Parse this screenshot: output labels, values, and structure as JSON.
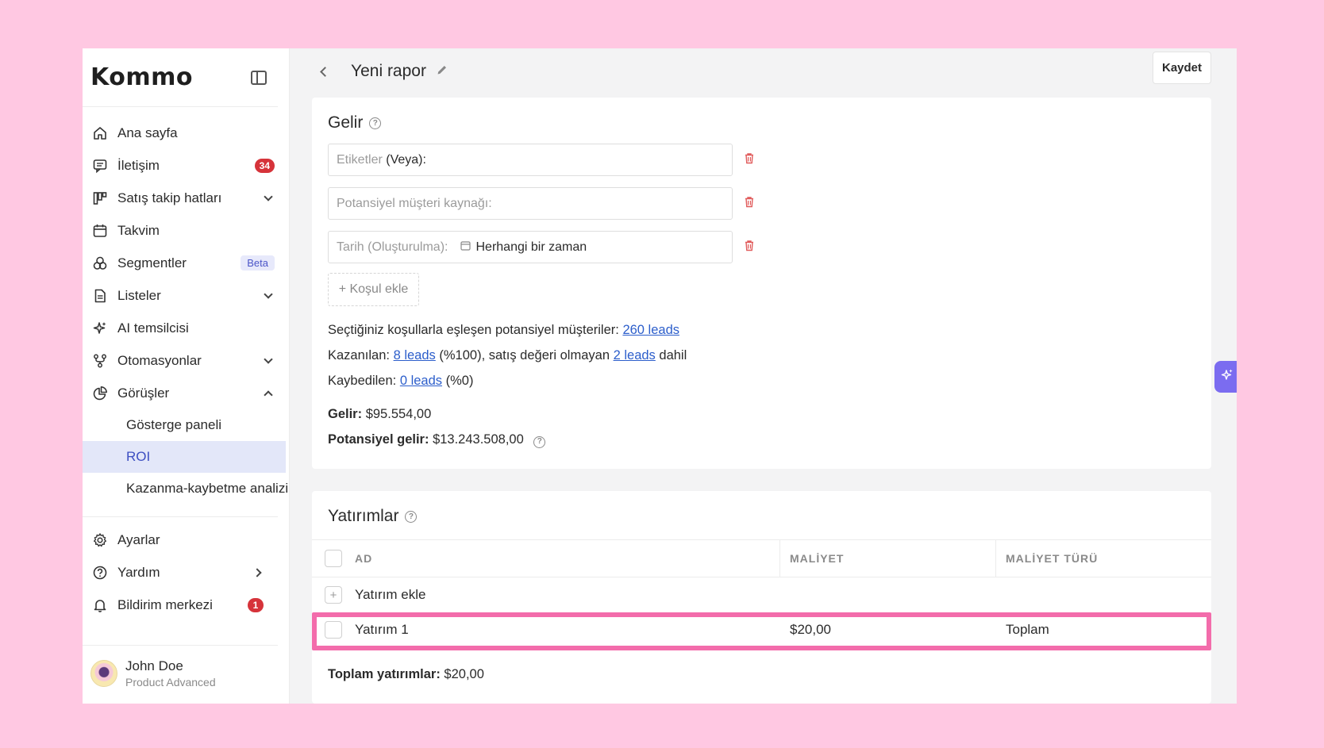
{
  "brand": {
    "logo": "Kommo"
  },
  "sidebar": {
    "items": [
      {
        "label": "Ana sayfa"
      },
      {
        "label": "İletişim",
        "badge": "34"
      },
      {
        "label": "Satış takip hatları"
      },
      {
        "label": "Takvim"
      },
      {
        "label": "Segmentler",
        "badge": "Beta"
      },
      {
        "label": "Listeler"
      },
      {
        "label": "AI temsilcisi"
      },
      {
        "label": "Otomasyonlar"
      },
      {
        "label": "Görüşler"
      }
    ],
    "sub_items": [
      {
        "label": "Gösterge paneli"
      },
      {
        "label": "ROI"
      },
      {
        "label": "Kazanma-kaybetme analizi"
      }
    ],
    "bottom": [
      {
        "label": "Ayarlar"
      },
      {
        "label": "Yardım"
      },
      {
        "label": "Bildirim merkezi",
        "badge": "1"
      }
    ],
    "user": {
      "name": "John Doe",
      "plan": "Product Advanced"
    }
  },
  "header": {
    "title": "Yeni rapor",
    "save_label": "Kaydet"
  },
  "income": {
    "title": "Gelir",
    "fields": {
      "tags_label": "Etiketler",
      "tags_suffix": "(Veya):",
      "source_placeholder": "Potansiyel müşteri kaynağı:",
      "date_label": "Tarih (Oluşturulma):",
      "date_value": "Herhangi bir zaman"
    },
    "add_condition": "+ Koşul ekle",
    "matched_text": "Seçtiğiniz koşullarla eşleşen potansiyel müşteriler:",
    "matched_link": "260 leads",
    "won_label": "Kazanılan:",
    "won_link": "8 leads",
    "won_mid": "(%100), satış değeri olmayan",
    "won_link2": "2 leads",
    "won_suffix": "dahil",
    "lost_label": "Kaybedilen:",
    "lost_link": "0 leads",
    "lost_suffix": "(%0)",
    "revenue_label": "Gelir:",
    "revenue_value": "$95.554,00",
    "potential_label": "Potansiyel gelir:",
    "potential_value": "$13.243.508,00"
  },
  "investments": {
    "title": "Yatırımlar",
    "columns": [
      "AD",
      "MALİYET",
      "MALİYET TÜRÜ"
    ],
    "add_label": "Yatırım ekle",
    "rows": [
      {
        "name": "Yatırım 1",
        "cost": "$20,00",
        "type": "Toplam"
      }
    ],
    "total_label": "Toplam yatırımlar:",
    "total_value": "$20,00"
  },
  "colors": {
    "accent": "#3d4fc2",
    "highlight": "#f36cab",
    "badge": "#d6333a",
    "link": "#2c5ecb"
  }
}
